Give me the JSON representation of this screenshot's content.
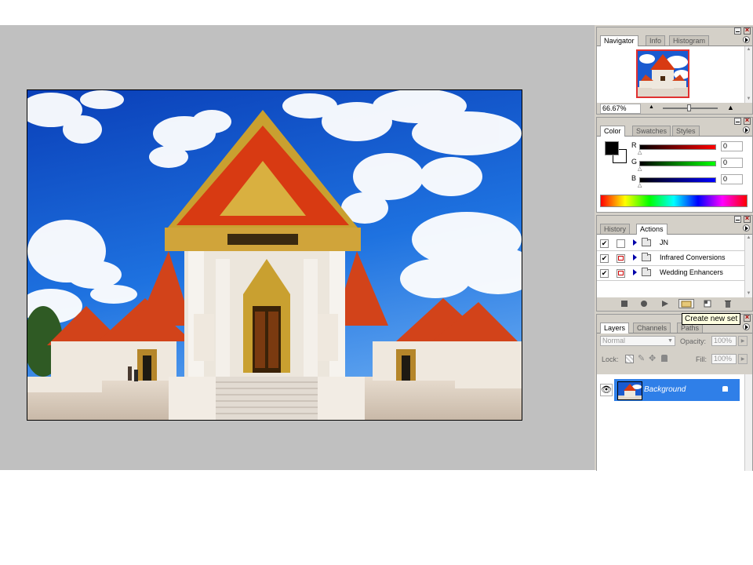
{
  "navigator": {
    "tabs": [
      "Navigator",
      "Info",
      "Histogram"
    ],
    "zoom": "66.67%"
  },
  "color": {
    "tabs": [
      "Color",
      "Swatches",
      "Styles"
    ],
    "channels": [
      {
        "label": "R",
        "value": "0",
        "color": "#ff0000"
      },
      {
        "label": "G",
        "value": "0",
        "color": "#00cc00"
      },
      {
        "label": "B",
        "value": "0",
        "color": "#0000ff"
      }
    ]
  },
  "actions": {
    "tabs": [
      "History",
      "Actions"
    ],
    "items": [
      {
        "label": "JN"
      },
      {
        "label": "Infrared Conversions"
      },
      {
        "label": "Wedding Enhancers"
      }
    ]
  },
  "tooltip": "Create new set",
  "layers": {
    "tabs": [
      "Layers",
      "Channels",
      "Paths"
    ],
    "blend_mode": "Normal",
    "opacity_label": "Opacity:",
    "opacity": "100%",
    "lock_label": "Lock:",
    "fill_label": "Fill:",
    "fill": "100%",
    "layer_name": "Background"
  }
}
